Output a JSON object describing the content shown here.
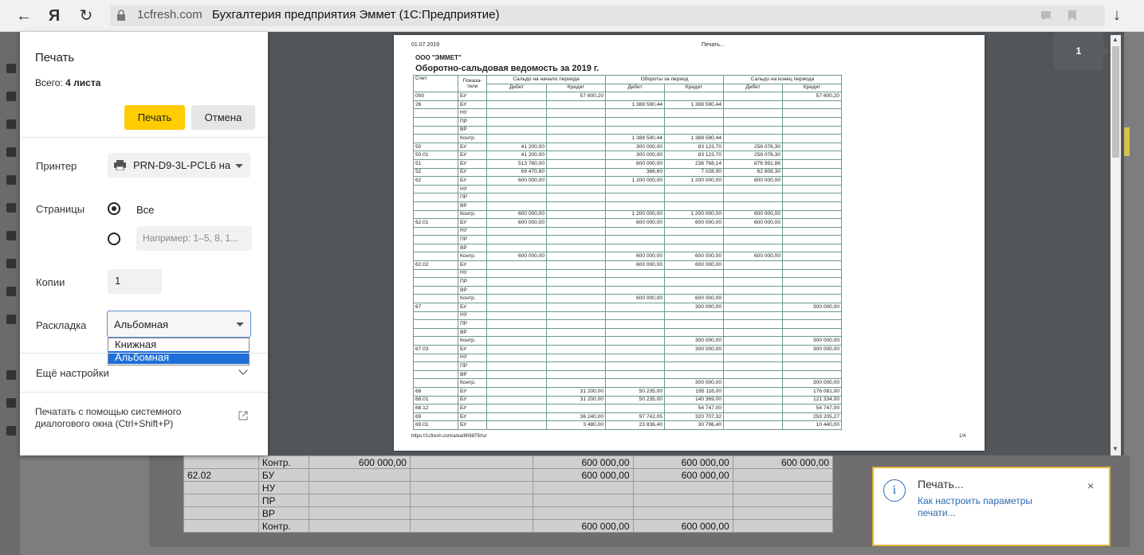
{
  "browser": {
    "back_icon": "←",
    "yandex_logo": "Я",
    "reload_icon": "↻",
    "host": "1cfresh.com",
    "page_title": "Бухгалтерия предприятия Эммет (1С:Предприятие)",
    "download_icon": "↓"
  },
  "print_dialog": {
    "title": "Печать",
    "total_label": "Всего:",
    "total_value": "4 листа",
    "print_button": "Печать",
    "cancel_button": "Отмена",
    "printer_label": "Принтер",
    "printer_value": "PRN-D9-3L-PCL6 на",
    "pages_label": "Страницы",
    "pages_all": "Все",
    "pages_placeholder": "Например: 1–5, 8, 1...",
    "copies_label": "Копии",
    "copies_value": "1",
    "layout_label": "Раскладка",
    "layout_value": "Альбомная",
    "layout_options": [
      "Книжная",
      "Альбомная"
    ],
    "more_settings": "Ещё настройки",
    "system_dialog": "Печатать с помощью системного диалогового окна (Ctrl+Shift+P)"
  },
  "preview": {
    "page_badge": "1",
    "date": "01.07.2019",
    "header_center": "Печать...",
    "org": "ООО \"ЭММЕТ\"",
    "title": "Оборотно-сальдовая ведомость за 2019 г.",
    "url": "https://1cfresh.com/a/ea/806879/ru/",
    "page_num": "1/4",
    "col_account": "Счет",
    "col_indicator": "Показа-тели",
    "col_open": "Сальдо на начало периода",
    "col_turn": "Обороты за период",
    "col_close": "Сальдо на конец периода",
    "col_debit": "Дебет",
    "col_credit": "Кредит",
    "rows": [
      [
        "000",
        "БУ",
        "",
        "57 600,20",
        "",
        "",
        "",
        "57 600,20"
      ],
      [
        "26",
        "БУ",
        "",
        "",
        "1 388 590,44",
        "1 388 590,44",
        "",
        ""
      ],
      [
        "",
        "НУ",
        "",
        "",
        "",
        "",
        "",
        ""
      ],
      [
        "",
        "ПР",
        "",
        "",
        "",
        "",
        "",
        ""
      ],
      [
        "",
        "ВР",
        "",
        "",
        "",
        "",
        "",
        ""
      ],
      [
        "",
        "Контр.",
        "",
        "",
        "1 388 590,44",
        "1 388 590,44",
        "",
        ""
      ],
      [
        "50",
        "БУ",
        "41 200,00",
        "",
        "300 000,00",
        "83 123,70",
        "258 076,30",
        ""
      ],
      [
        "50.01",
        "БУ",
        "41 200,00",
        "",
        "300 000,00",
        "83 123,70",
        "258 076,30",
        ""
      ],
      [
        "51",
        "БУ",
        "513 760,00",
        "",
        "600 000,00",
        "236 768,14",
        "876 991,86",
        ""
      ],
      [
        "52",
        "БУ",
        "69 470,60",
        "",
        "366,60",
        "7 028,90",
        "62 808,30",
        ""
      ],
      [
        "62",
        "БУ",
        "600 000,00",
        "",
        "1 200 000,00",
        "1 200 000,00",
        "600 000,00",
        ""
      ],
      [
        "",
        "НУ",
        "",
        "",
        "",
        "",
        "",
        ""
      ],
      [
        "",
        "ПР",
        "",
        "",
        "",
        "",
        "",
        ""
      ],
      [
        "",
        "ВР",
        "",
        "",
        "",
        "",
        "",
        ""
      ],
      [
        "",
        "Контр.",
        "600 000,00",
        "",
        "1 200 000,00",
        "1 200 000,00",
        "600 000,00",
        ""
      ],
      [
        "62.01",
        "БУ",
        "600 000,00",
        "",
        "600 000,00",
        "600 000,00",
        "600 000,00",
        ""
      ],
      [
        "",
        "НУ",
        "",
        "",
        "",
        "",
        "",
        ""
      ],
      [
        "",
        "ПР",
        "",
        "",
        "",
        "",
        "",
        ""
      ],
      [
        "",
        "ВР",
        "",
        "",
        "",
        "",
        "",
        ""
      ],
      [
        "",
        "Контр.",
        "600 000,00",
        "",
        "600 000,00",
        "600 000,00",
        "600 000,00",
        ""
      ],
      [
        "62.02",
        "БУ",
        "",
        "",
        "600 000,00",
        "600 000,00",
        "",
        ""
      ],
      [
        "",
        "НУ",
        "",
        "",
        "",
        "",
        "",
        ""
      ],
      [
        "",
        "ПР",
        "",
        "",
        "",
        "",
        "",
        ""
      ],
      [
        "",
        "ВР",
        "",
        "",
        "",
        "",
        "",
        ""
      ],
      [
        "",
        "Контр.",
        "",
        "",
        "600 000,00",
        "600 000,00",
        "",
        ""
      ],
      [
        "67",
        "БУ",
        "",
        "",
        "",
        "300 000,00",
        "",
        "300 000,00"
      ],
      [
        "",
        "НУ",
        "",
        "",
        "",
        "",
        "",
        ""
      ],
      [
        "",
        "ПР",
        "",
        "",
        "",
        "",
        "",
        ""
      ],
      [
        "",
        "ВР",
        "",
        "",
        "",
        "",
        "",
        ""
      ],
      [
        "",
        "Контр.",
        "",
        "",
        "",
        "300 000,00",
        "",
        "300 000,00"
      ],
      [
        "67.03",
        "БУ",
        "",
        "",
        "",
        "300 000,00",
        "",
        "300 000,00"
      ],
      [
        "",
        "НУ",
        "",
        "",
        "",
        "",
        "",
        ""
      ],
      [
        "",
        "ПР",
        "",
        "",
        "",
        "",
        "",
        ""
      ],
      [
        "",
        "ВР",
        "",
        "",
        "",
        "",
        "",
        ""
      ],
      [
        "",
        "Контр.",
        "",
        "",
        "",
        "300 000,00",
        "",
        "300 000,00"
      ],
      [
        "68",
        "БУ",
        "",
        "31 200,00",
        "50 235,00",
        "195 116,00",
        "",
        "176 081,00"
      ],
      [
        "68.01",
        "БУ",
        "",
        "31 200,00",
        "50 235,00",
        "140 369,00",
        "",
        "121 334,00"
      ],
      [
        "68.12",
        "БУ",
        "",
        "",
        "",
        "54 747,00",
        "",
        "54 747,00"
      ],
      [
        "69",
        "БУ",
        "",
        "36 240,00",
        "97 742,05",
        "320 707,32",
        "",
        "259 205,27"
      ],
      [
        "69.01",
        "БУ",
        "",
        "3 480,00",
        "23 836,40",
        "30 796,40",
        "",
        "10 440,00"
      ]
    ]
  },
  "background_table": {
    "rows": [
      [
        "",
        "Контр.",
        "600 000,00",
        "",
        "600 000,00",
        "600 000,00",
        "600 000,00"
      ],
      [
        "62.02",
        "БУ",
        "",
        "",
        "600 000,00",
        "600 000,00",
        ""
      ],
      [
        "",
        "НУ",
        "",
        "",
        "",
        "",
        ""
      ],
      [
        "",
        "ПР",
        "",
        "",
        "",
        "",
        ""
      ],
      [
        "",
        "ВР",
        "",
        "",
        "",
        "",
        ""
      ],
      [
        "",
        "Контр.",
        "",
        "",
        "600 000,00",
        "600 000,00",
        ""
      ]
    ]
  },
  "toast": {
    "info_icon": "i",
    "title": "Печать...",
    "link": "Как настроить параметры печати...",
    "close_icon": "×"
  },
  "colors": {
    "accent_yellow": "#ffcc00",
    "toast_border": "#e2b33a",
    "selection_blue": "#1e6fd9",
    "link_blue": "#2f6bb3"
  }
}
